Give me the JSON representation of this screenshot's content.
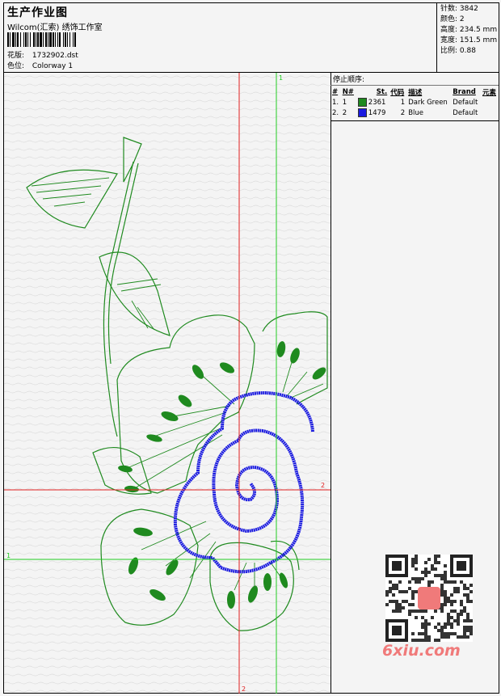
{
  "header": {
    "title": "生产作业图",
    "company": "Wilcom(汇索) 绣饰工作室",
    "design_label": "花版:",
    "design_value": "1732902.dst",
    "colorway_label": "色位:",
    "colorway_value": "Colorway 1"
  },
  "stats": [
    {
      "label": "针数",
      "value": "3842"
    },
    {
      "label": "颜色",
      "value": "2"
    },
    {
      "label": "高度",
      "value": "234.5 mm"
    },
    {
      "label": "宽度",
      "value": "151.5 mm"
    },
    {
      "label": "比例",
      "value": "0.88"
    }
  ],
  "stop_sequence": {
    "title": "停止顺序:",
    "columns": [
      "#",
      "N#",
      "St.",
      "代码",
      "描述",
      "Brand",
      "元素"
    ],
    "rows": [
      {
        "index": "1.",
        "n": "1",
        "stitches": "2361",
        "code": "1",
        "desc": "Dark Green",
        "brand": "Default",
        "color": "#1f8a1f"
      },
      {
        "index": "2.",
        "n": "2",
        "stitches": "1479",
        "code": "2",
        "desc": "Blue",
        "brand": "Default",
        "color": "#1a1ae0"
      }
    ]
  },
  "guides": {
    "vertical_green_label": "1",
    "horizontal_green_label": "1",
    "vertical_red_label": "2",
    "horizontal_red_label": "2",
    "green": "#22cc22",
    "red": "#e02020"
  },
  "colors": {
    "thread_green": "#1f8a1f",
    "thread_blue": "#1a1ae0"
  },
  "watermark": "6xiu.com"
}
